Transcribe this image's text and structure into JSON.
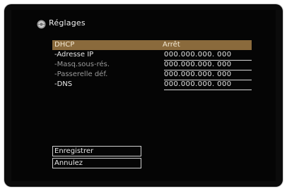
{
  "header": {
    "title": "Réglages",
    "icon": "settings-gear-icon"
  },
  "rows": [
    {
      "label": "DHCP",
      "value": "Arrêt",
      "selected": true
    },
    {
      "label": "-Adresse IP",
      "value": "000.000.000. 000"
    },
    {
      "label": "-Masq.sous-rés.",
      "value": "000.000.000. 000"
    },
    {
      "label": "-Passerelle déf.",
      "value": "000.000.000. 000"
    },
    {
      "label": "-DNS",
      "value": "000.000.000. 000"
    }
  ],
  "buttons": {
    "save_label": "Enregistrer",
    "cancel_label": "Annulez"
  },
  "colors": {
    "highlight": "#8a6a3c",
    "background": "#050505",
    "text": "#e8e8e8"
  }
}
